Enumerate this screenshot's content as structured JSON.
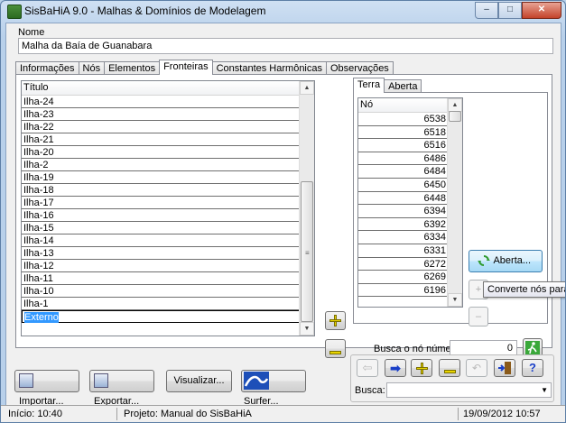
{
  "window": {
    "title": "SisBaHiA 9.0 - Malhas & Domínios de Modelagem",
    "min": "–",
    "max": "□",
    "close": "✕"
  },
  "name_field": {
    "label": "Nome",
    "value": "Malha da Baía de Guanabara"
  },
  "main_tabs": [
    {
      "label": "Informações"
    },
    {
      "label": "Nós"
    },
    {
      "label": "Elementos"
    },
    {
      "label": "Fronteiras"
    },
    {
      "label": "Constantes Harmônicas"
    },
    {
      "label": "Observações"
    }
  ],
  "titles_grid": {
    "header": "Título",
    "rows": [
      "Ilha-24",
      "Ilha-23",
      "Ilha-22",
      "Ilha-21",
      "Ilha-20",
      "Ilha-2",
      "Ilha-19",
      "Ilha-18",
      "Ilha-17",
      "Ilha-16",
      "Ilha-15",
      "Ilha-14",
      "Ilha-13",
      "Ilha-12",
      "Ilha-11",
      "Ilha-10",
      "Ilha-1",
      "Externo"
    ],
    "selected_index": 17
  },
  "sub_tabs": [
    {
      "label": "Terra"
    },
    {
      "label": "Aberta"
    }
  ],
  "nodes_grid": {
    "header": "Nó",
    "rows": [
      "6538",
      "6518",
      "6516",
      "6486",
      "6484",
      "6450",
      "6448",
      "6394",
      "6392",
      "6334",
      "6331",
      "6272",
      "6269",
      "6196"
    ]
  },
  "aberta_button": {
    "label": "Aberta..."
  },
  "tooltip": {
    "text": "Converte nós para a fr"
  },
  "search_node": {
    "label": "Busca o nó número:",
    "value": "0"
  },
  "bottom_buttons": {
    "importar": "Importar...",
    "exportar": "Exportar...",
    "visualizar": "Visualizar...",
    "surfer": "Surfer..."
  },
  "busca": {
    "label": "Busca:",
    "value": ""
  },
  "status": {
    "inicio": "Início: 10:40",
    "projeto": "Projeto: Manual do SisBaHiA",
    "datetime": "19/09/2012 10:57"
  },
  "colors": {
    "accent": "#3399ff",
    "nav_blue": "#1a3fc8",
    "yellow": "#e8d400",
    "green": "#2f9a2f"
  }
}
